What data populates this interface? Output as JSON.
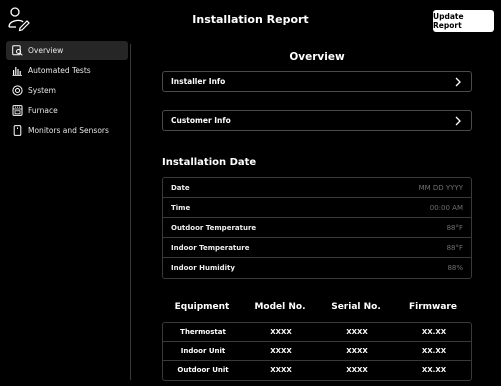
{
  "header": {
    "title": "Installation Report",
    "update_button": "Update Report"
  },
  "sidebar": {
    "items": [
      {
        "label": "Overview",
        "icon": "overview-icon",
        "active": true
      },
      {
        "label": "Automated Tests",
        "icon": "bar-chart-icon",
        "active": false
      },
      {
        "label": "System",
        "icon": "system-icon",
        "active": false
      },
      {
        "label": "Furnace",
        "icon": "furnace-icon",
        "active": false
      },
      {
        "label": "Monitors and Sensors",
        "icon": "sensor-icon",
        "active": false
      }
    ]
  },
  "main": {
    "overview_title": "Overview",
    "sections": [
      {
        "label": "Installer Info"
      },
      {
        "label": "Customer Info"
      }
    ],
    "installation_date": {
      "title": "Installation Date",
      "rows": [
        {
          "label": "Date",
          "value": "MM DD YYYY"
        },
        {
          "label": "Time",
          "value": "00:00 AM"
        },
        {
          "label": "Outdoor Temperature",
          "value": "88°F"
        },
        {
          "label": "Indoor Temperature",
          "value": "88°F"
        },
        {
          "label": "Indoor Humidity",
          "value": "88%"
        }
      ]
    },
    "equipment": {
      "headers": [
        "Equipment",
        "Model No.",
        "Serial No.",
        "Firmware"
      ],
      "rows": [
        [
          "Thermostat",
          "XXXX",
          "XXXX",
          "XX.XX"
        ],
        [
          "Indoor Unit",
          "XXXX",
          "XXXX",
          "XX.XX"
        ],
        [
          "Outdoor Unit",
          "XXXX",
          "XXXX",
          "XX.XX"
        ]
      ]
    }
  },
  "colors": {
    "background": "#000000",
    "text": "#ffffff",
    "muted_value": "#6f6f6f",
    "border": "#3a3a3a",
    "active_nav": "#262626",
    "button_bg": "#ffffff"
  }
}
